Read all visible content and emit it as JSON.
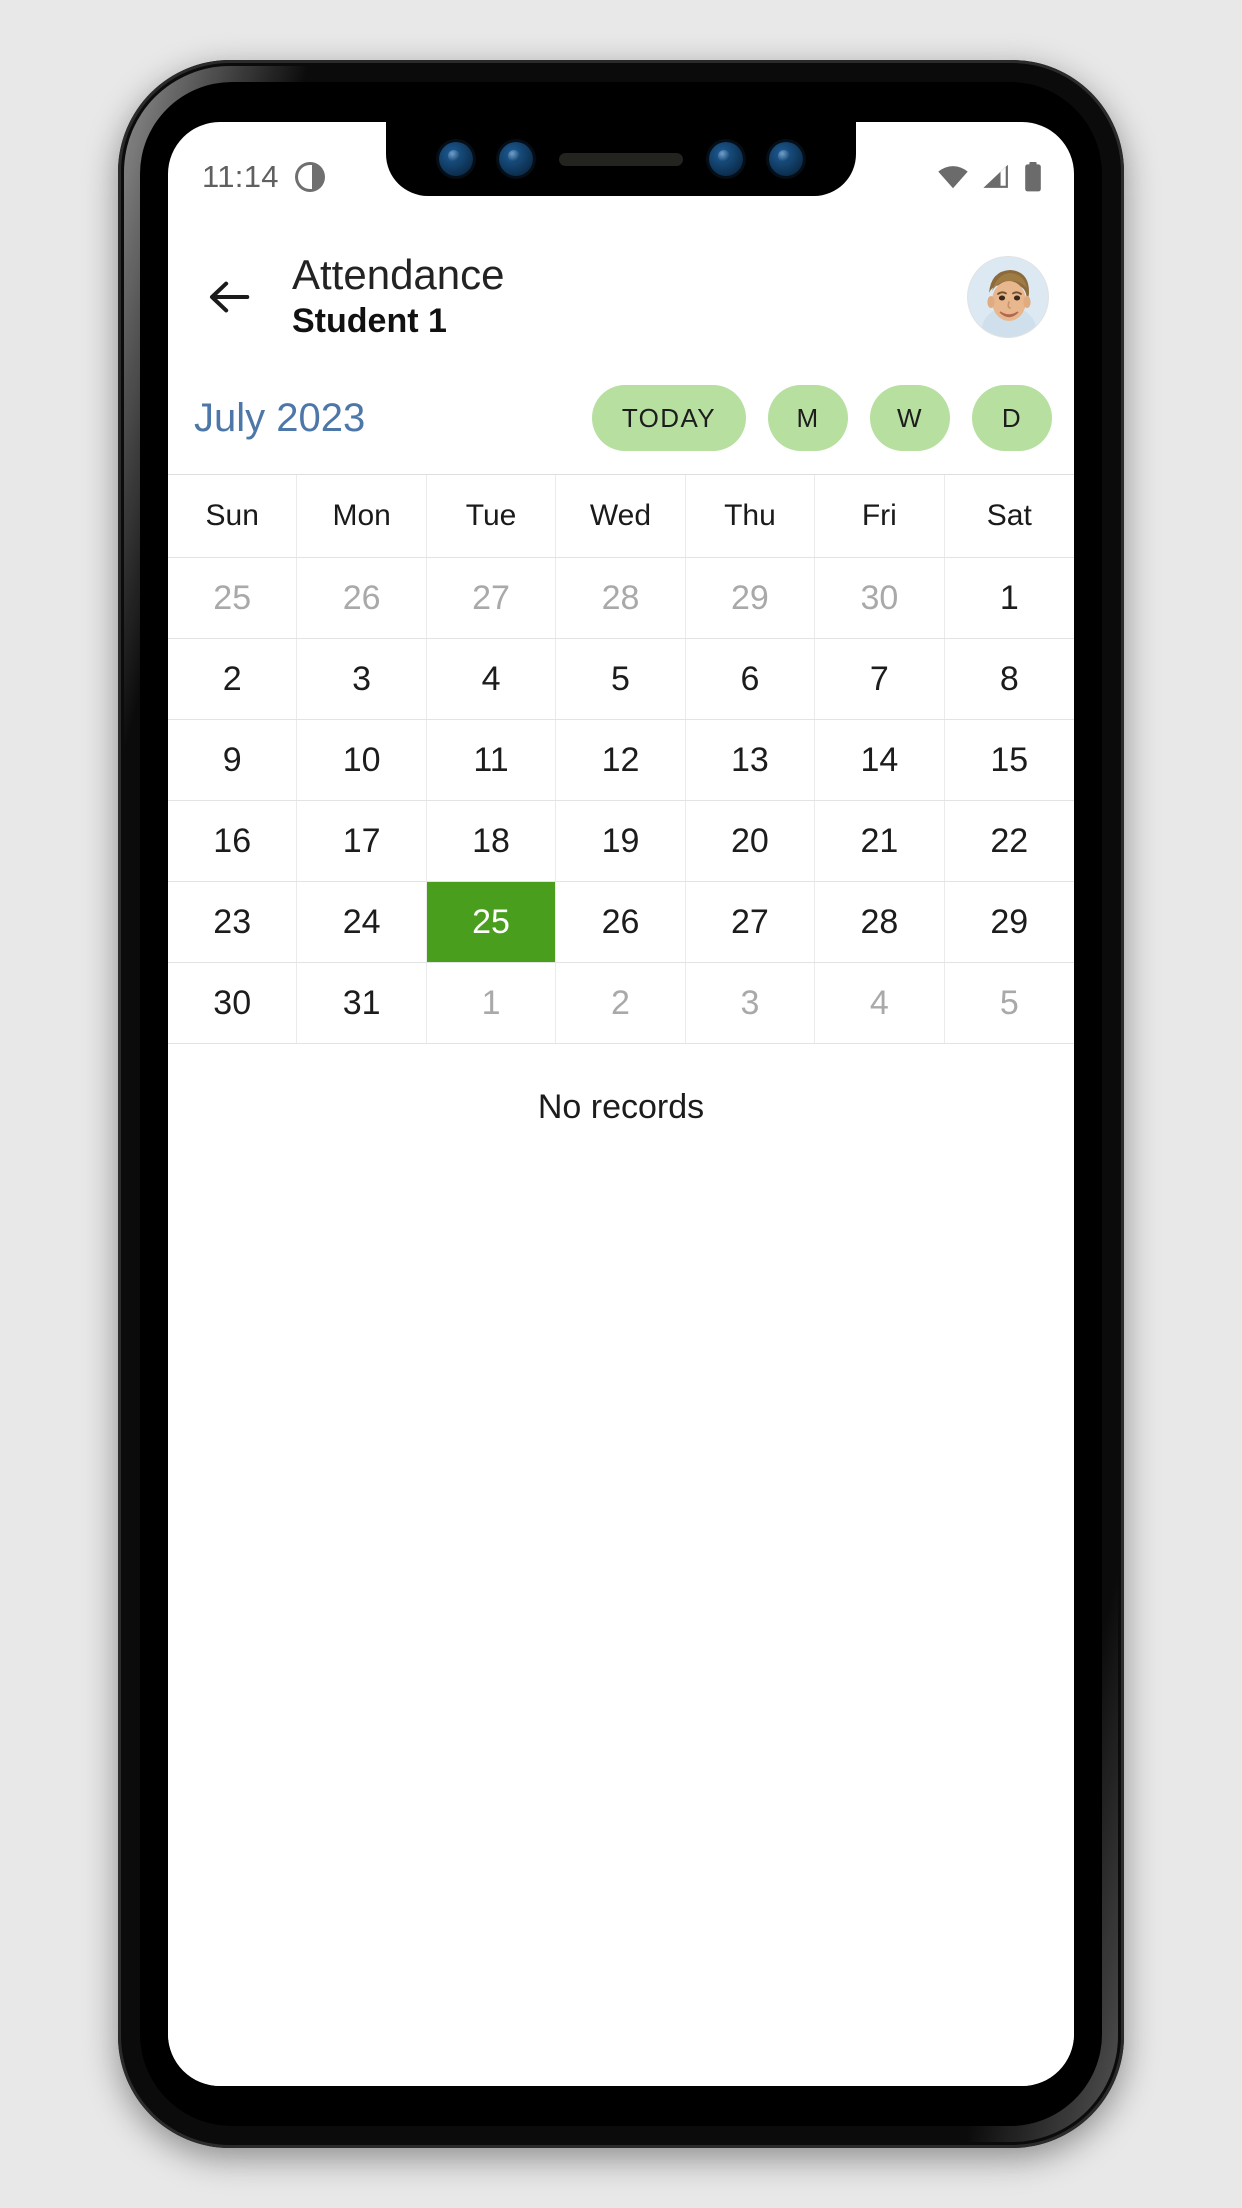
{
  "status_bar": {
    "time": "11:14",
    "dnd_icon": "do-not-disturb-icon",
    "wifi_icon": "wifi-icon",
    "signal_icon": "cellular-signal-icon",
    "battery_icon": "battery-full-icon"
  },
  "header": {
    "back_icon": "back-arrow-icon",
    "title": "Attendance",
    "subtitle": "Student 1",
    "avatar_name": "student-avatar"
  },
  "toolbar": {
    "month_label": "July 2023",
    "month_color": "#4d77a8",
    "chips": [
      {
        "label": "TODAY",
        "name": "chip-today",
        "shape": "wide"
      },
      {
        "label": "M",
        "name": "chip-month",
        "shape": "round"
      },
      {
        "label": "W",
        "name": "chip-week",
        "shape": "round"
      },
      {
        "label": "D",
        "name": "chip-day",
        "shape": "round"
      }
    ],
    "chip_color": "#b6dfa0"
  },
  "calendar": {
    "weekdays": [
      "Sun",
      "Mon",
      "Tue",
      "Wed",
      "Thu",
      "Fri",
      "Sat"
    ],
    "selected_color": "#4a9e1e",
    "weeks": [
      [
        {
          "day": "25",
          "state": "muted"
        },
        {
          "day": "26",
          "state": "muted"
        },
        {
          "day": "27",
          "state": "muted"
        },
        {
          "day": "28",
          "state": "muted"
        },
        {
          "day": "29",
          "state": "muted"
        },
        {
          "day": "30",
          "state": "muted"
        },
        {
          "day": "1",
          "state": "current"
        }
      ],
      [
        {
          "day": "2",
          "state": "current"
        },
        {
          "day": "3",
          "state": "current"
        },
        {
          "day": "4",
          "state": "current"
        },
        {
          "day": "5",
          "state": "current"
        },
        {
          "day": "6",
          "state": "current"
        },
        {
          "day": "7",
          "state": "current"
        },
        {
          "day": "8",
          "state": "current"
        }
      ],
      [
        {
          "day": "9",
          "state": "current"
        },
        {
          "day": "10",
          "state": "current"
        },
        {
          "day": "11",
          "state": "current"
        },
        {
          "day": "12",
          "state": "current"
        },
        {
          "day": "13",
          "state": "current"
        },
        {
          "day": "14",
          "state": "current"
        },
        {
          "day": "15",
          "state": "current"
        }
      ],
      [
        {
          "day": "16",
          "state": "current"
        },
        {
          "day": "17",
          "state": "current"
        },
        {
          "day": "18",
          "state": "current"
        },
        {
          "day": "19",
          "state": "current"
        },
        {
          "day": "20",
          "state": "current"
        },
        {
          "day": "21",
          "state": "current"
        },
        {
          "day": "22",
          "state": "current"
        }
      ],
      [
        {
          "day": "23",
          "state": "current"
        },
        {
          "day": "24",
          "state": "current"
        },
        {
          "day": "25",
          "state": "selected"
        },
        {
          "day": "26",
          "state": "current"
        },
        {
          "day": "27",
          "state": "current"
        },
        {
          "day": "28",
          "state": "current"
        },
        {
          "day": "29",
          "state": "current"
        }
      ],
      [
        {
          "day": "30",
          "state": "current"
        },
        {
          "day": "31",
          "state": "current"
        },
        {
          "day": "1",
          "state": "muted"
        },
        {
          "day": "2",
          "state": "muted"
        },
        {
          "day": "3",
          "state": "muted"
        },
        {
          "day": "4",
          "state": "muted"
        },
        {
          "day": "5",
          "state": "muted"
        }
      ]
    ]
  },
  "records": {
    "empty_text": "No records"
  }
}
